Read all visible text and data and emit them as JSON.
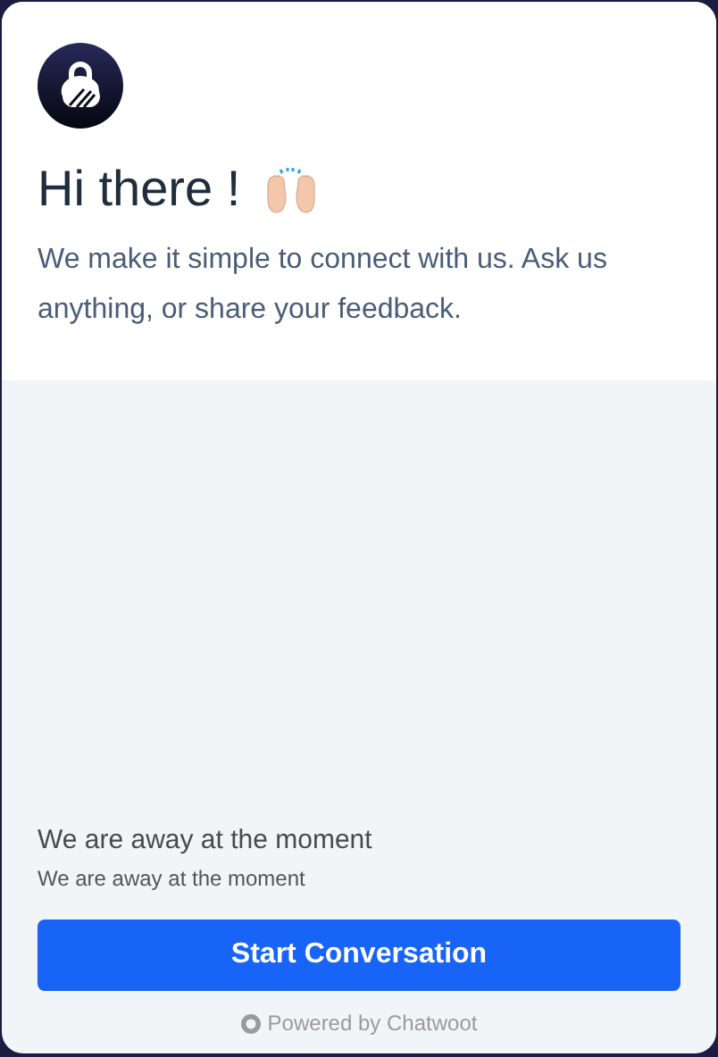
{
  "header": {
    "title": "Hi there !",
    "intro": "We make it simple to connect with us. Ask us anything, or share your feedback."
  },
  "availability": {
    "heading": "We are away at the moment",
    "message": "We are away at the moment"
  },
  "start_button": "Start Conversation",
  "footer": {
    "branding": "Powered by Chatwoot"
  }
}
